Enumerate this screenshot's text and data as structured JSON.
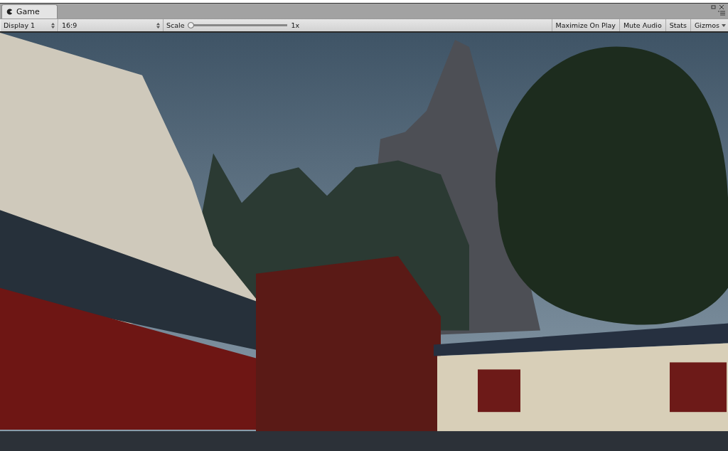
{
  "tab": {
    "label": "Game",
    "selected": true
  },
  "toolbar": {
    "display": "Display 1",
    "aspect": "16:9",
    "scale": {
      "label": "Scale",
      "level": 0,
      "reading": "1x"
    },
    "toggles": [
      {
        "label": "Maximize On Play",
        "on": false
      },
      {
        "label": "Mute Audio",
        "on": false
      },
      {
        "label": "Stats",
        "on": false
      }
    ],
    "gizmos": "Gizmos"
  }
}
